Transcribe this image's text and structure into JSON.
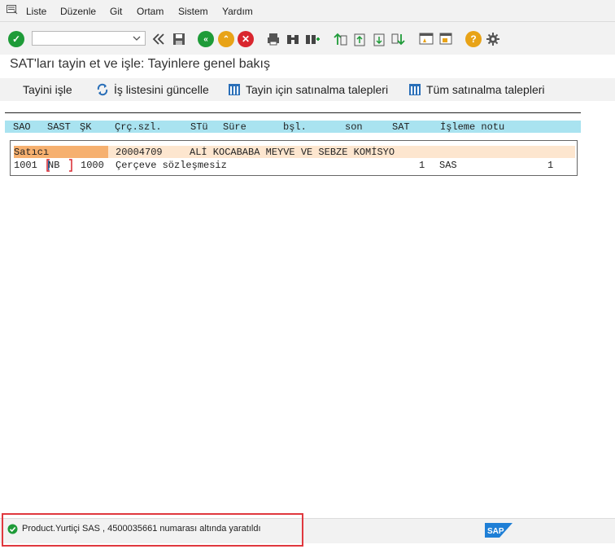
{
  "menu": {
    "items": [
      "Liste",
      "Düzenle",
      "Git",
      "Ortam",
      "Sistem",
      "Yardım"
    ]
  },
  "toolbar": {
    "command_field_value": ""
  },
  "screen": {
    "title": "SAT'ları tayin et ve işle: Tayinlere genel bakış"
  },
  "app_toolbar": {
    "buttons": [
      "Tayini işle",
      "İş listesini güncelle",
      "Tayin için satınalma talepleri",
      "Tüm satınalma talepleri"
    ]
  },
  "table": {
    "headers": [
      "SAO",
      "SAST",
      "ŞK",
      "Çrç.szl.",
      "STü",
      "Süre",
      "bşl.",
      "son",
      "SAT",
      "İşleme notu"
    ],
    "vendor": {
      "label": "Satıcı",
      "number": "20004709",
      "name": "ALİ KOCABABA MEYVE VE SEBZE KOMİSYO"
    },
    "row": {
      "sao": "1001",
      "sast": "NB",
      "sk": "1000",
      "crc": "Çerçeve sözleşmesiz",
      "sat": "1",
      "note": "SAS",
      "count": "1"
    }
  },
  "status": {
    "message": "Product.Yurtiçi SAS , 4500035661 numarası altında yaratıldı",
    "type": "success",
    "color": "#1e9b38"
  }
}
